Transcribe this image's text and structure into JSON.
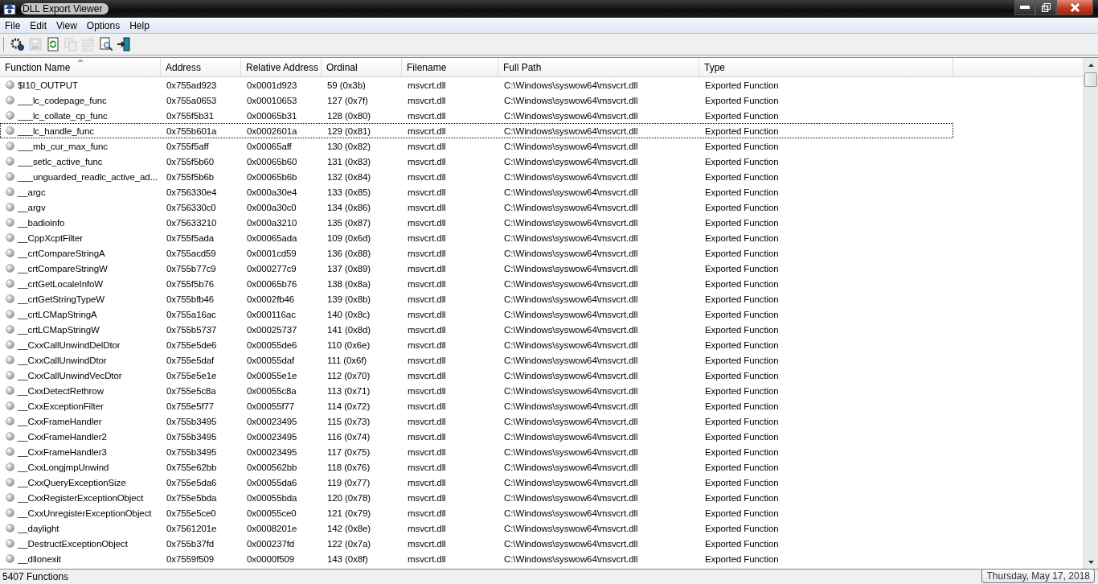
{
  "window": {
    "title": "DLL Export Viewer"
  },
  "menu": [
    "File",
    "Edit",
    "View",
    "Options",
    "Help"
  ],
  "toolbar": [
    {
      "kind": "options",
      "disabled": false
    },
    {
      "kind": "save",
      "disabled": true
    },
    {
      "kind": "refresh",
      "disabled": false
    },
    {
      "kind": "copy",
      "disabled": true
    },
    {
      "kind": "properties",
      "disabled": true
    },
    {
      "kind": "find",
      "disabled": false
    },
    {
      "kind": "exit",
      "disabled": false
    }
  ],
  "table": {
    "columns": [
      {
        "label": "Function Name",
        "sorted": true
      },
      {
        "label": "Address",
        "sorted": false
      },
      {
        "label": "Relative Address",
        "sorted": false
      },
      {
        "label": "Ordinal",
        "sorted": false
      },
      {
        "label": "Filename",
        "sorted": false
      },
      {
        "label": "Full Path",
        "sorted": false
      },
      {
        "label": "Type",
        "sorted": false
      }
    ],
    "rows": [
      {
        "focused": false,
        "cells": [
          "$I10_OUTPUT",
          "0x755ad923",
          "0x0001d923",
          "59 (0x3b)",
          "msvcrt.dll",
          "C:\\Windows\\syswow64\\msvcrt.dll",
          "Exported Function"
        ]
      },
      {
        "focused": false,
        "cells": [
          "___lc_codepage_func",
          "0x755a0653",
          "0x00010653",
          "127 (0x7f)",
          "msvcrt.dll",
          "C:\\Windows\\syswow64\\msvcrt.dll",
          "Exported Function"
        ]
      },
      {
        "focused": false,
        "cells": [
          "___lc_collate_cp_func",
          "0x755f5b31",
          "0x00065b31",
          "128 (0x80)",
          "msvcrt.dll",
          "C:\\Windows\\syswow64\\msvcrt.dll",
          "Exported Function"
        ]
      },
      {
        "focused": true,
        "cells": [
          "___lc_handle_func",
          "0x755b601a",
          "0x0002601a",
          "129 (0x81)",
          "msvcrt.dll",
          "C:\\Windows\\syswow64\\msvcrt.dll",
          "Exported Function"
        ]
      },
      {
        "focused": false,
        "cells": [
          "___mb_cur_max_func",
          "0x755f5aff",
          "0x00065aff",
          "130 (0x82)",
          "msvcrt.dll",
          "C:\\Windows\\syswow64\\msvcrt.dll",
          "Exported Function"
        ]
      },
      {
        "focused": false,
        "cells": [
          "___setlc_active_func",
          "0x755f5b60",
          "0x00065b60",
          "131 (0x83)",
          "msvcrt.dll",
          "C:\\Windows\\syswow64\\msvcrt.dll",
          "Exported Function"
        ]
      },
      {
        "focused": false,
        "cells": [
          "___unguarded_readlc_active_ad...",
          "0x755f5b6b",
          "0x00065b6b",
          "132 (0x84)",
          "msvcrt.dll",
          "C:\\Windows\\syswow64\\msvcrt.dll",
          "Exported Function"
        ]
      },
      {
        "focused": false,
        "cells": [
          "__argc",
          "0x756330e4",
          "0x000a30e4",
          "133 (0x85)",
          "msvcrt.dll",
          "C:\\Windows\\syswow64\\msvcrt.dll",
          "Exported Function"
        ]
      },
      {
        "focused": false,
        "cells": [
          "__argv",
          "0x756330c0",
          "0x000a30c0",
          "134 (0x86)",
          "msvcrt.dll",
          "C:\\Windows\\syswow64\\msvcrt.dll",
          "Exported Function"
        ]
      },
      {
        "focused": false,
        "cells": [
          "__badioinfo",
          "0x75633210",
          "0x000a3210",
          "135 (0x87)",
          "msvcrt.dll",
          "C:\\Windows\\syswow64\\msvcrt.dll",
          "Exported Function"
        ]
      },
      {
        "focused": false,
        "cells": [
          "__CppXcptFilter",
          "0x755f5ada",
          "0x00065ada",
          "109 (0x6d)",
          "msvcrt.dll",
          "C:\\Windows\\syswow64\\msvcrt.dll",
          "Exported Function"
        ]
      },
      {
        "focused": false,
        "cells": [
          "__crtCompareStringA",
          "0x755acd59",
          "0x0001cd59",
          "136 (0x88)",
          "msvcrt.dll",
          "C:\\Windows\\syswow64\\msvcrt.dll",
          "Exported Function"
        ]
      },
      {
        "focused": false,
        "cells": [
          "__crtCompareStringW",
          "0x755b77c9",
          "0x000277c9",
          "137 (0x89)",
          "msvcrt.dll",
          "C:\\Windows\\syswow64\\msvcrt.dll",
          "Exported Function"
        ]
      },
      {
        "focused": false,
        "cells": [
          "__crtGetLocaleInfoW",
          "0x755f5b76",
          "0x00065b76",
          "138 (0x8a)",
          "msvcrt.dll",
          "C:\\Windows\\syswow64\\msvcrt.dll",
          "Exported Function"
        ]
      },
      {
        "focused": false,
        "cells": [
          "__crtGetStringTypeW",
          "0x755bfb46",
          "0x0002fb46",
          "139 (0x8b)",
          "msvcrt.dll",
          "C:\\Windows\\syswow64\\msvcrt.dll",
          "Exported Function"
        ]
      },
      {
        "focused": false,
        "cells": [
          "__crtLCMapStringA",
          "0x755a16ac",
          "0x000116ac",
          "140 (0x8c)",
          "msvcrt.dll",
          "C:\\Windows\\syswow64\\msvcrt.dll",
          "Exported Function"
        ]
      },
      {
        "focused": false,
        "cells": [
          "__crtLCMapStringW",
          "0x755b5737",
          "0x00025737",
          "141 (0x8d)",
          "msvcrt.dll",
          "C:\\Windows\\syswow64\\msvcrt.dll",
          "Exported Function"
        ]
      },
      {
        "focused": false,
        "cells": [
          "__CxxCallUnwindDelDtor",
          "0x755e5de6",
          "0x00055de6",
          "110 (0x6e)",
          "msvcrt.dll",
          "C:\\Windows\\syswow64\\msvcrt.dll",
          "Exported Function"
        ]
      },
      {
        "focused": false,
        "cells": [
          "__CxxCallUnwindDtor",
          "0x755e5daf",
          "0x00055daf",
          "111 (0x6f)",
          "msvcrt.dll",
          "C:\\Windows\\syswow64\\msvcrt.dll",
          "Exported Function"
        ]
      },
      {
        "focused": false,
        "cells": [
          "__CxxCallUnwindVecDtor",
          "0x755e5e1e",
          "0x00055e1e",
          "112 (0x70)",
          "msvcrt.dll",
          "C:\\Windows\\syswow64\\msvcrt.dll",
          "Exported Function"
        ]
      },
      {
        "focused": false,
        "cells": [
          "__CxxDetectRethrow",
          "0x755e5c8a",
          "0x00055c8a",
          "113 (0x71)",
          "msvcrt.dll",
          "C:\\Windows\\syswow64\\msvcrt.dll",
          "Exported Function"
        ]
      },
      {
        "focused": false,
        "cells": [
          "__CxxExceptionFilter",
          "0x755e5f77",
          "0x00055f77",
          "114 (0x72)",
          "msvcrt.dll",
          "C:\\Windows\\syswow64\\msvcrt.dll",
          "Exported Function"
        ]
      },
      {
        "focused": false,
        "cells": [
          "__CxxFrameHandler",
          "0x755b3495",
          "0x00023495",
          "115 (0x73)",
          "msvcrt.dll",
          "C:\\Windows\\syswow64\\msvcrt.dll",
          "Exported Function"
        ]
      },
      {
        "focused": false,
        "cells": [
          "__CxxFrameHandler2",
          "0x755b3495",
          "0x00023495",
          "116 (0x74)",
          "msvcrt.dll",
          "C:\\Windows\\syswow64\\msvcrt.dll",
          "Exported Function"
        ]
      },
      {
        "focused": false,
        "cells": [
          "__CxxFrameHandler3",
          "0x755b3495",
          "0x00023495",
          "117 (0x75)",
          "msvcrt.dll",
          "C:\\Windows\\syswow64\\msvcrt.dll",
          "Exported Function"
        ]
      },
      {
        "focused": false,
        "cells": [
          "__CxxLongjmpUnwind",
          "0x755e62bb",
          "0x000562bb",
          "118 (0x76)",
          "msvcrt.dll",
          "C:\\Windows\\syswow64\\msvcrt.dll",
          "Exported Function"
        ]
      },
      {
        "focused": false,
        "cells": [
          "__CxxQueryExceptionSize",
          "0x755e5da6",
          "0x00055da6",
          "119 (0x77)",
          "msvcrt.dll",
          "C:\\Windows\\syswow64\\msvcrt.dll",
          "Exported Function"
        ]
      },
      {
        "focused": false,
        "cells": [
          "__CxxRegisterExceptionObject",
          "0x755e5bda",
          "0x00055bda",
          "120 (0x78)",
          "msvcrt.dll",
          "C:\\Windows\\syswow64\\msvcrt.dll",
          "Exported Function"
        ]
      },
      {
        "focused": false,
        "cells": [
          "__CxxUnregisterExceptionObject",
          "0x755e5ce0",
          "0x00055ce0",
          "121 (0x79)",
          "msvcrt.dll",
          "C:\\Windows\\syswow64\\msvcrt.dll",
          "Exported Function"
        ]
      },
      {
        "focused": false,
        "cells": [
          "__daylight",
          "0x7561201e",
          "0x0008201e",
          "142 (0x8e)",
          "msvcrt.dll",
          "C:\\Windows\\syswow64\\msvcrt.dll",
          "Exported Function"
        ]
      },
      {
        "focused": false,
        "cells": [
          "__DestructExceptionObject",
          "0x755b37fd",
          "0x000237fd",
          "122 (0x7a)",
          "msvcrt.dll",
          "C:\\Windows\\syswow64\\msvcrt.dll",
          "Exported Function"
        ]
      },
      {
        "focused": false,
        "cells": [
          "__dllonexit",
          "0x7559f509",
          "0x0000f509",
          "143 (0x8f)",
          "msvcrt.dll",
          "C:\\Windows\\syswow64\\msvcrt.dll",
          "Exported Function"
        ]
      }
    ]
  },
  "status_bar": {
    "text": "5407 Functions"
  },
  "tooltip": {
    "text": "Thursday, May 17, 2018"
  }
}
